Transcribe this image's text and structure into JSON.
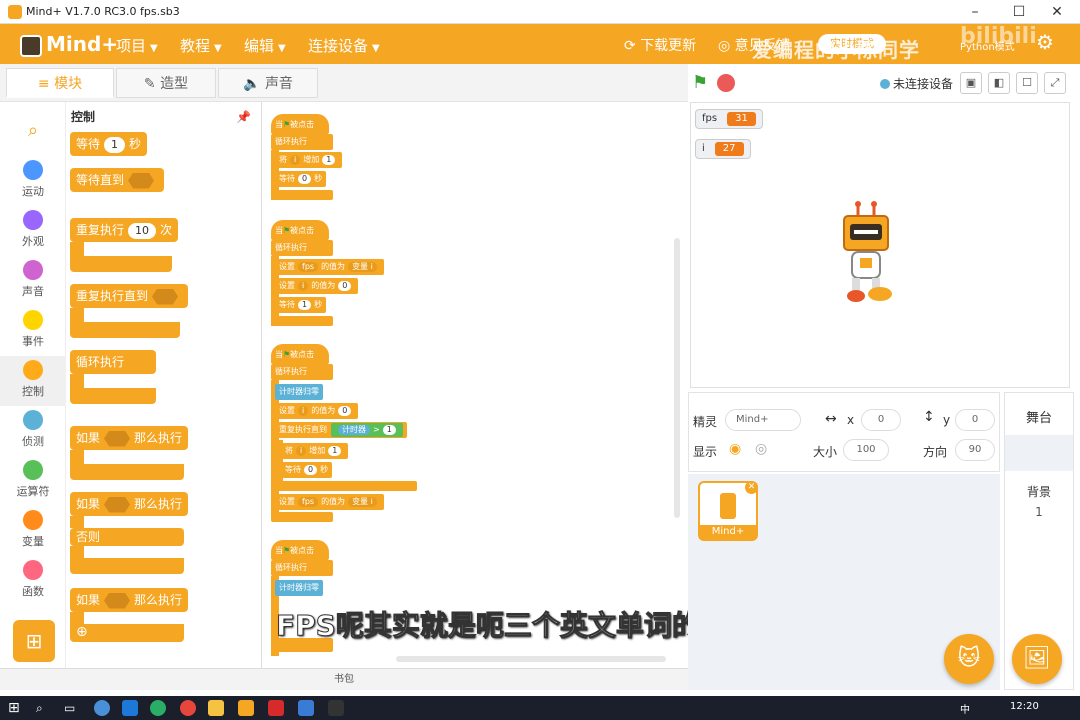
{
  "window": {
    "title": "Mind+  V1.7.0 RC3.0    fps.sb3"
  },
  "menu": {
    "brand": "Mind+",
    "items": [
      "项目",
      "教程",
      "编辑",
      "连接设备"
    ],
    "update": "下载更新",
    "feedback": "意见反馈",
    "mode": "实时模式",
    "python": "Python模式",
    "watermark": "爱编程的小陈同学",
    "watermark2": "bilibili"
  },
  "tabs": [
    "模块",
    "造型",
    "声音"
  ],
  "categories": [
    {
      "label": "运动",
      "color": "#4c97ff"
    },
    {
      "label": "外观",
      "color": "#9966ff"
    },
    {
      "label": "声音",
      "color": "#cf63cf"
    },
    {
      "label": "事件",
      "color": "#ffd500"
    },
    {
      "label": "控制",
      "color": "#ffab19"
    },
    {
      "label": "侦测",
      "color": "#5cb1d6"
    },
    {
      "label": "运算符",
      "color": "#59c059"
    },
    {
      "label": "变量",
      "color": "#ff8c1a"
    },
    {
      "label": "函数",
      "color": "#ff6680"
    }
  ],
  "palette": {
    "title": "控制",
    "wait": {
      "a": "等待",
      "n": "1",
      "b": "秒"
    },
    "wait_until": "等待直到",
    "repeat": {
      "a": "重复执行",
      "n": "10",
      "b": "次"
    },
    "repeat_until": "重复执行直到",
    "forever": "循环执行",
    "if_then": {
      "a": "如果",
      "b": "那么执行"
    },
    "if_else": {
      "a": "如果",
      "b": "那么执行",
      "c": "否则"
    },
    "if_then2": {
      "a": "如果",
      "b": "那么执行"
    }
  },
  "scripts": {
    "hat": "当",
    "hat_b": "被点击",
    "forever": "循环执行",
    "change": "将",
    "change_b": "增加",
    "wait": "等待",
    "wait_b": "秒",
    "set": "设置",
    "set_b": "的值为",
    "var_prefix": "变量",
    "reset_timer": "计时器归零",
    "repeat_until": "重复执行直到",
    "timer": "计时器",
    "gt": ">",
    "vars": {
      "fps": "fps",
      "i": "i"
    },
    "nums": {
      "one": "1",
      "zero": "0"
    }
  },
  "subtitle": "FPS呢其实就是呃三个英文单词的缩写",
  "backpack": "书包",
  "stage": {
    "connect": "未连接设备",
    "monitors": [
      {
        "name": "fps",
        "value": "31"
      },
      {
        "name": "i",
        "value": "27"
      }
    ]
  },
  "sprite_info": {
    "sprite_label": "精灵",
    "sprite_name": "Mind+",
    "x_label": "x",
    "x": "0",
    "y_label": "y",
    "y": "0",
    "show_label": "显示",
    "size_label": "大小",
    "size": "100",
    "dir_label": "方向",
    "dir": "90"
  },
  "sprite_card": {
    "name": "Mind+"
  },
  "stage_col": {
    "title": "舞台",
    "bg_label": "背景",
    "bg_count": "1"
  },
  "taskbar": {
    "time": "12:20",
    "ime": "中"
  }
}
